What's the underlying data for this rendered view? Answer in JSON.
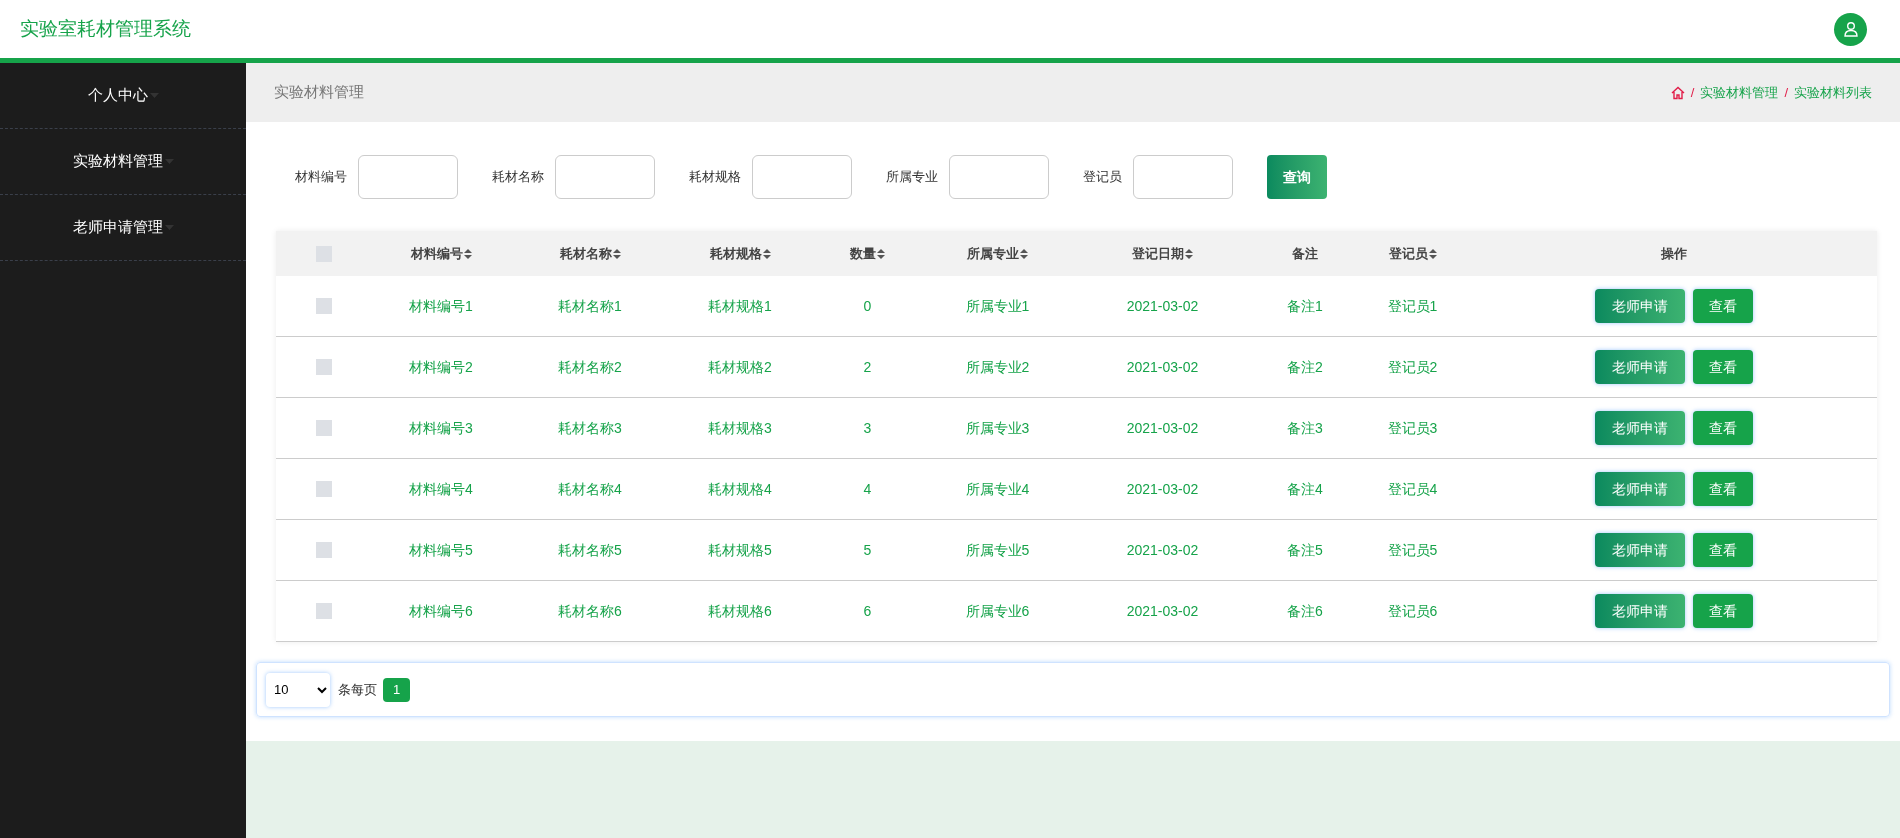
{
  "header": {
    "title": "实验室耗材管理系统"
  },
  "sidebar": {
    "items": [
      {
        "label": "个人中心",
        "expanded": false
      },
      {
        "label": "实验材料管理",
        "expanded": false
      },
      {
        "label": "老师申请管理",
        "expanded": false
      }
    ]
  },
  "breadcrumb_bar": {
    "title": "实验材料管理",
    "crumbs": [
      {
        "separator": "/",
        "label": "实验材料管理"
      },
      {
        "separator": "/",
        "label": "实验材料列表"
      }
    ]
  },
  "search": {
    "fields": [
      {
        "label": "材料编号"
      },
      {
        "label": "耗材名称"
      },
      {
        "label": "耗材规格"
      },
      {
        "label": "所属专业"
      },
      {
        "label": "登记员"
      }
    ],
    "button": "查询"
  },
  "table": {
    "columns": [
      {
        "label": "材料编号",
        "sortable": true
      },
      {
        "label": "耗材名称",
        "sortable": true
      },
      {
        "label": "耗材规格",
        "sortable": true
      },
      {
        "label": "数量",
        "sortable": true
      },
      {
        "label": "所属专业",
        "sortable": true
      },
      {
        "label": "登记日期",
        "sortable": true
      },
      {
        "label": "备注",
        "sortable": false
      },
      {
        "label": "登记员",
        "sortable": true
      },
      {
        "label": "操作",
        "sortable": false
      }
    ],
    "all_checked": false,
    "rows": [
      {
        "checked": false,
        "cells": [
          "材料编号1",
          "耗材名称1",
          "耗材规格1",
          "0",
          "所属专业1",
          "2021-03-02",
          "备注1",
          "登记员1"
        ],
        "actions": [
          "老师申请",
          "查看"
        ]
      },
      {
        "checked": false,
        "cells": [
          "材料编号2",
          "耗材名称2",
          "耗材规格2",
          "2",
          "所属专业2",
          "2021-03-02",
          "备注2",
          "登记员2"
        ],
        "actions": [
          "老师申请",
          "查看"
        ]
      },
      {
        "checked": false,
        "cells": [
          "材料编号3",
          "耗材名称3",
          "耗材规格3",
          "3",
          "所属专业3",
          "2021-03-02",
          "备注3",
          "登记员3"
        ],
        "actions": [
          "老师申请",
          "查看"
        ]
      },
      {
        "checked": false,
        "cells": [
          "材料编号4",
          "耗材名称4",
          "耗材规格4",
          "4",
          "所属专业4",
          "2021-03-02",
          "备注4",
          "登记员4"
        ],
        "actions": [
          "老师申请",
          "查看"
        ]
      },
      {
        "checked": false,
        "cells": [
          "材料编号5",
          "耗材名称5",
          "耗材规格5",
          "5",
          "所属专业5",
          "2021-03-02",
          "备注5",
          "登记员5"
        ],
        "actions": [
          "老师申请",
          "查看"
        ]
      },
      {
        "checked": false,
        "cells": [
          "材料编号6",
          "耗材名称6",
          "耗材规格6",
          "6",
          "所属专业6",
          "2021-03-02",
          "备注6",
          "登记员6"
        ],
        "actions": [
          "老师申请",
          "查看"
        ]
      }
    ]
  },
  "pagination": {
    "page_size": "10",
    "per_page_label": "条每页",
    "pages": [
      {
        "label": "1",
        "selected": true
      }
    ]
  }
}
